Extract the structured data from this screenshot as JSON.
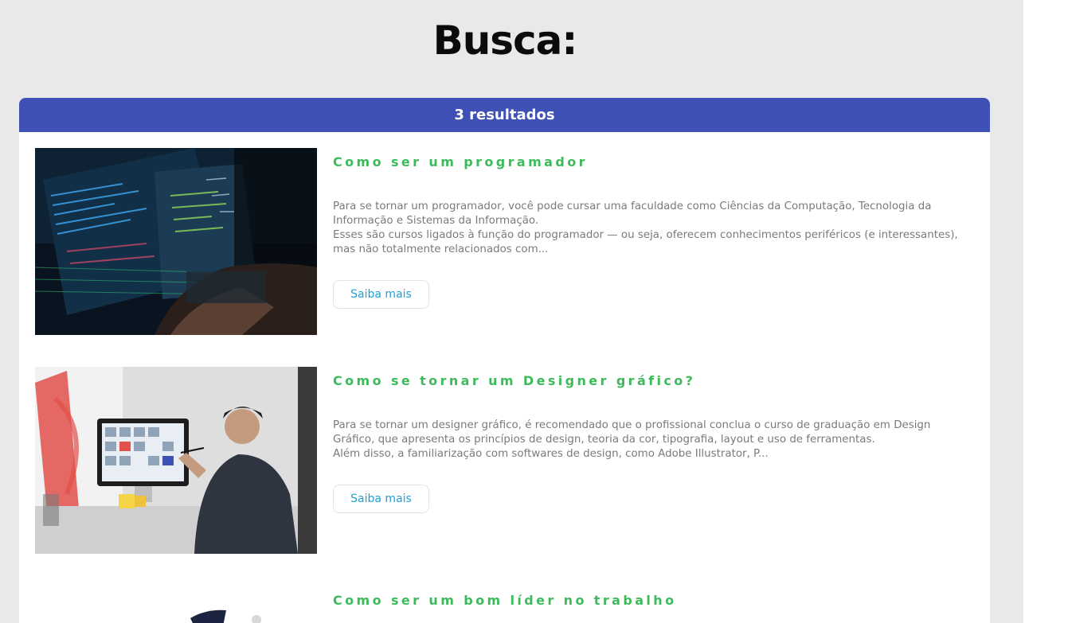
{
  "page": {
    "title": "Busca:"
  },
  "results": {
    "count_label": "3 resultados",
    "items": [
      {
        "title": "Como ser um programador",
        "excerpt_lines": [
          "Para se tornar um programador, você pode cursar uma faculdade como Ciências da Computação, Tecnologia da Informação e Sistemas da Informação.",
          "Esses são cursos ligados à função do programador — ou seja, oferecem conhecimentos periféricos (e interessantes), mas não totalmente relacionados com..."
        ],
        "button_label": "Saiba mais"
      },
      {
        "title": "Como se tornar um Designer gráfico?",
        "excerpt_lines": [
          "Para se tornar um designer gráfico, é recomendado que o profissional conclua o curso de graduação em Design Gráfico, que apresenta os princípios de design, teoria da cor, tipografia, layout e uso de ferramentas.",
          "Além disso, a familiarização com softwares de design, como Adobe Illustrator, P..."
        ],
        "button_label": "Saiba mais"
      },
      {
        "title": "Como ser um bom líder no trabalho"
      }
    ]
  },
  "colors": {
    "header_bg": "#3f51b5",
    "title_green": "#3dbb5b",
    "link_blue": "#1fa1d6",
    "page_bg": "#e9e9e9"
  }
}
